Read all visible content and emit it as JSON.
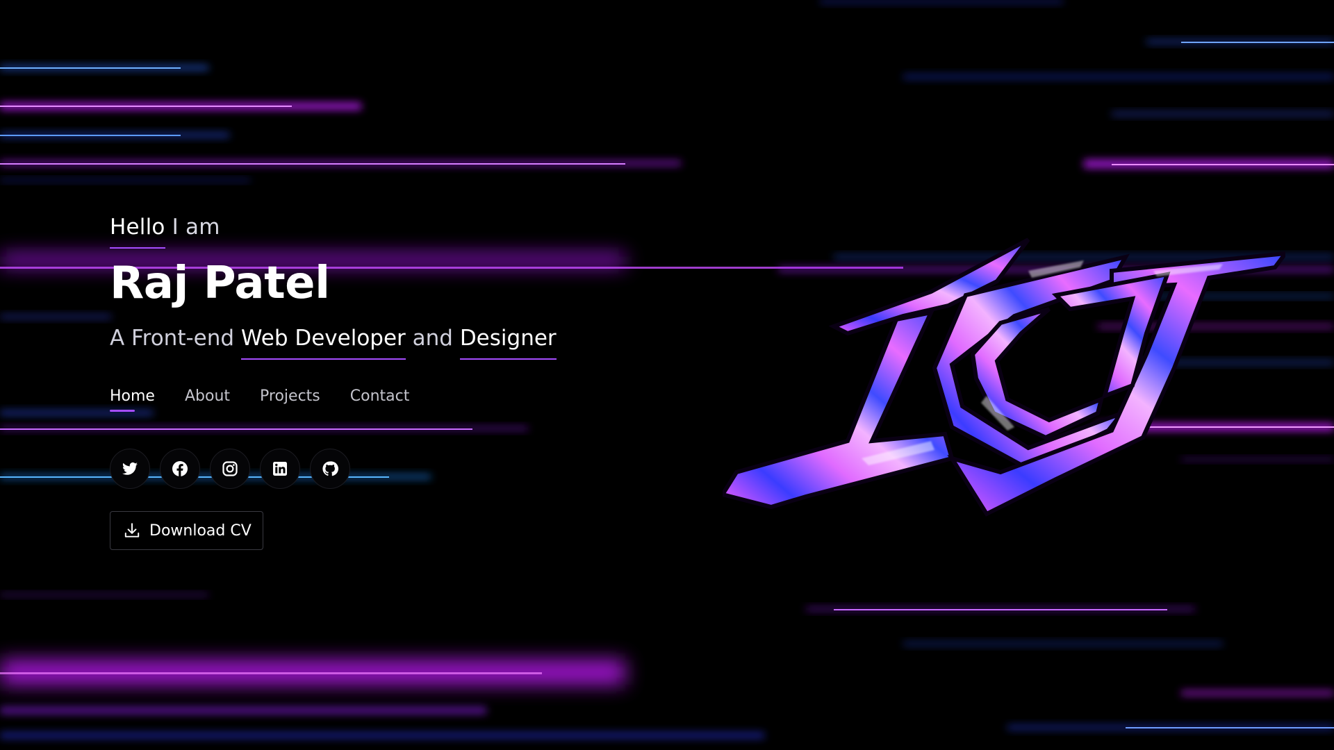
{
  "hero": {
    "greeting_hello": "Hello",
    "greeting_rest": " I am",
    "name": "Raj Patel",
    "tagline_prefix": "A Front-end ",
    "tagline_role1": "Web Developer",
    "tagline_mid": " and ",
    "tagline_role2": "Designer"
  },
  "nav": {
    "items": [
      {
        "label": "Home",
        "active": true
      },
      {
        "label": "About",
        "active": false
      },
      {
        "label": "Projects",
        "active": false
      },
      {
        "label": "Contact",
        "active": false
      }
    ]
  },
  "socials": [
    {
      "icon": "twitter-icon"
    },
    {
      "icon": "facebook-icon"
    },
    {
      "icon": "instagram-icon"
    },
    {
      "icon": "linkedin-icon"
    },
    {
      "icon": "github-icon"
    }
  ],
  "cta": {
    "download_label": "Download CV",
    "icon": "download-icon"
  },
  "logo": {
    "description_icon": "rp-monogram-logo"
  },
  "colors": {
    "background": "#000000",
    "accent": "#a64dff",
    "magenta": "#e040fb",
    "blue": "#2f4bff",
    "text": "#ffffff"
  }
}
